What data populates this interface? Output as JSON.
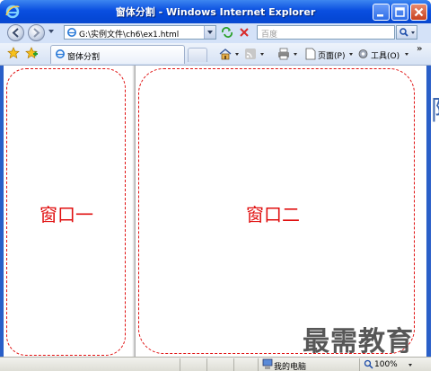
{
  "window": {
    "title": "窗体分割 - Windows Internet Explorer"
  },
  "address_bar": {
    "url": "G:\\实例文件\\ch6\\ex1.html",
    "search_placeholder": "百度"
  },
  "command_bar": {
    "tab_title": "窗体分割",
    "page_menu": "页面(P)",
    "tools_menu": "工具(O)",
    "overflow": "»"
  },
  "content": {
    "left_frame_label": "窗口一",
    "right_frame_label": "窗口二"
  },
  "status_bar": {
    "zone": "我的电脑",
    "zoom": "100%"
  },
  "watermark": "最需教育",
  "background_glyph": "阿",
  "colors": {
    "title_bar": "#0548d6",
    "frame_border": "#e01010",
    "frame_text": "#e01010"
  },
  "icons": [
    "ie-logo-icon",
    "minimize-icon",
    "maximize-icon",
    "close-icon",
    "back-icon",
    "forward-icon",
    "refresh-icon",
    "stop-icon",
    "search-icon",
    "favorites-star-icon",
    "add-favorite-icon",
    "home-icon",
    "feeds-icon",
    "print-icon",
    "page-icon",
    "tools-gear-icon",
    "computer-zone-icon",
    "zoom-icon"
  ]
}
